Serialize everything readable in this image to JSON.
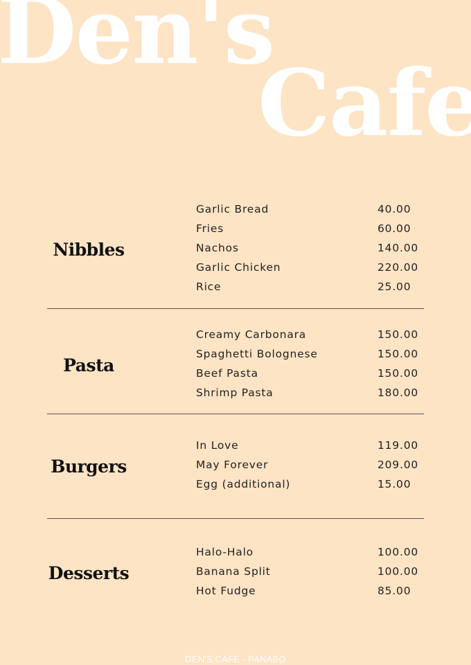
{
  "brand": {
    "line1": "Den's",
    "line2": "Cafe"
  },
  "sections": [
    {
      "category": "Nibbles",
      "items": [
        {
          "name": "Garlic Bread",
          "price": "40.00"
        },
        {
          "name": "Fries",
          "price": "60.00"
        },
        {
          "name": "Nachos",
          "price": "140.00"
        },
        {
          "name": "Garlic Chicken",
          "price": "220.00"
        },
        {
          "name": "Rice",
          "price": "25.00"
        }
      ]
    },
    {
      "category": "Pasta",
      "items": [
        {
          "name": "Creamy Carbonara",
          "price": "150.00"
        },
        {
          "name": "Spaghetti Bolognese",
          "price": "150.00"
        },
        {
          "name": "Beef Pasta",
          "price": "150.00"
        },
        {
          "name": "Shrimp Pasta",
          "price": "180.00"
        }
      ]
    },
    {
      "category": "Burgers",
      "items": [
        {
          "name": "In Love",
          "price": "119.00"
        },
        {
          "name": "May Forever",
          "price": "209.00"
        },
        {
          "name": "Egg (additional)",
          "price": "15.00"
        }
      ]
    },
    {
      "category": "Desserts",
      "items": [
        {
          "name": "Halo-Halo",
          "price": "100.00"
        },
        {
          "name": "Banana Split",
          "price": "100.00"
        },
        {
          "name": "Hot Fudge",
          "price": "85.00"
        }
      ]
    }
  ],
  "footer": "DEN'S CAFE - PANABO"
}
